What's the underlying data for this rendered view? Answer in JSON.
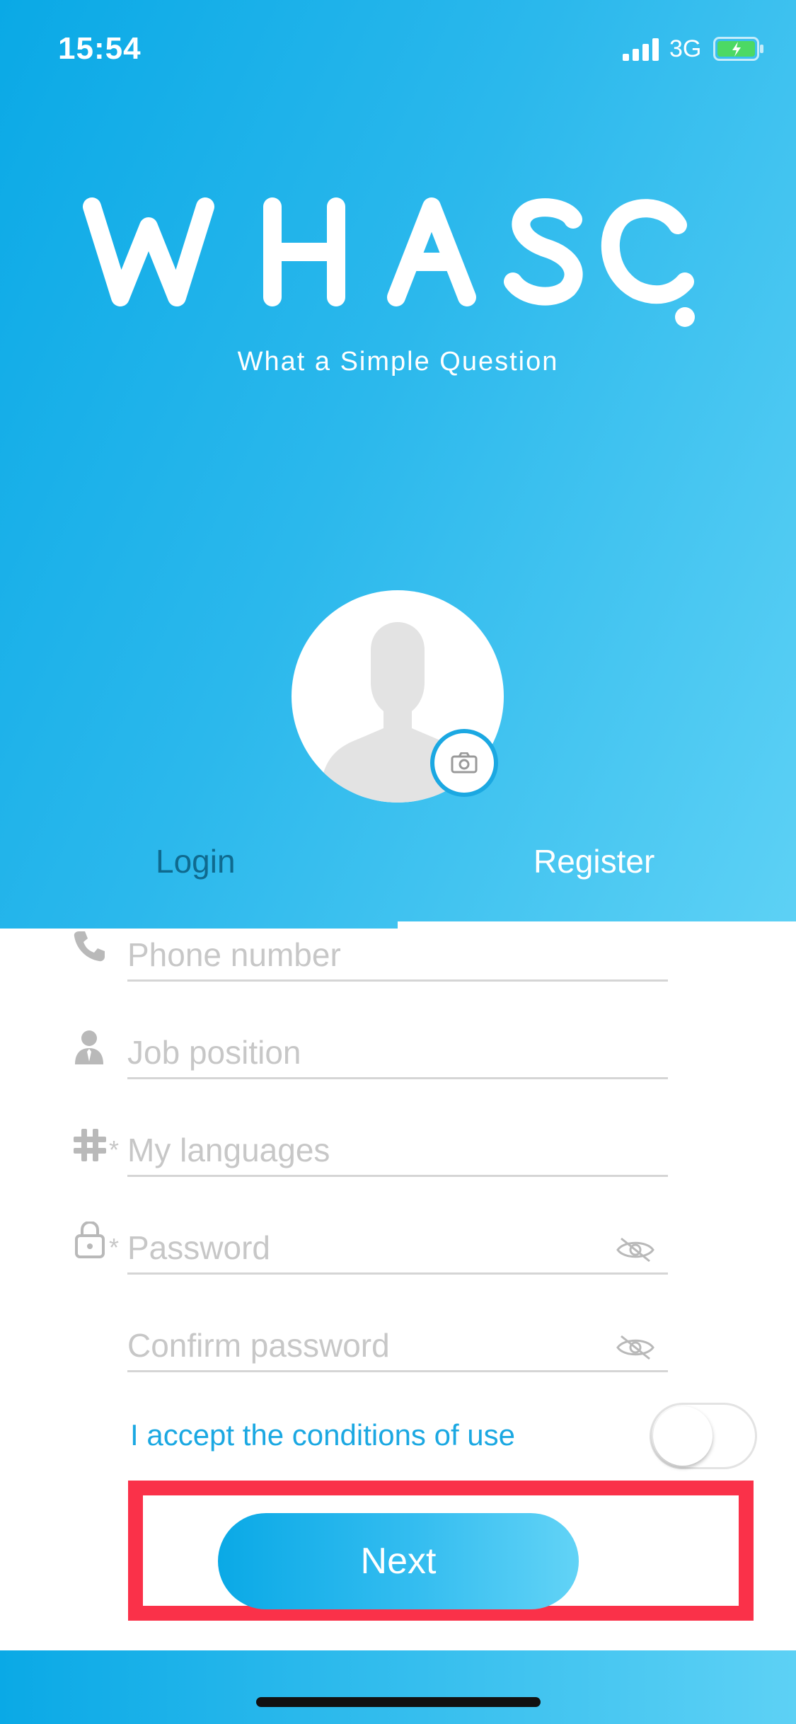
{
  "status_bar": {
    "time": "15:54",
    "network": "3G"
  },
  "brand": {
    "logo_text": "WHASQ",
    "tagline": "What a Simple Question"
  },
  "tabs": {
    "login": "Login",
    "register": "Register",
    "active": "register"
  },
  "form": {
    "phone_placeholder": "Phone number",
    "job_placeholder": "Job position",
    "languages_placeholder": "My languages",
    "password_placeholder": "Password",
    "confirm_password_placeholder": "Confirm password",
    "required_mark": "*",
    "accept_label": "I accept the conditions of use",
    "accept_toggle_on": false
  },
  "actions": {
    "next_label": "Next"
  },
  "colors": {
    "accent": "#1ba8e2",
    "highlight": "#fa3149",
    "placeholder": "#c7c7c7"
  },
  "icons": [
    "signal-icon",
    "battery-icon",
    "avatar-icon",
    "camera-icon",
    "phone-icon",
    "person-icon",
    "hash-icon",
    "lock-icon",
    "eye-slash-icon"
  ]
}
